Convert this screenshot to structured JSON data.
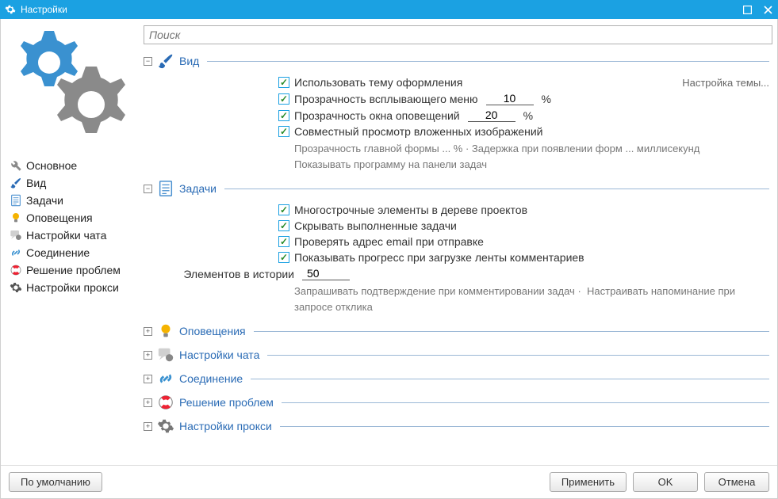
{
  "window": {
    "title": "Настройки"
  },
  "search": {
    "placeholder": "Поиск"
  },
  "sidebar": {
    "items": [
      {
        "label": "Основное"
      },
      {
        "label": "Вид"
      },
      {
        "label": "Задачи"
      },
      {
        "label": "Оповещения"
      },
      {
        "label": "Настройки чата"
      },
      {
        "label": "Соединение"
      },
      {
        "label": "Решение проблем"
      },
      {
        "label": "Настройки прокси"
      }
    ]
  },
  "sections": {
    "view": {
      "title": "Вид",
      "use_theme": "Использовать тему оформления",
      "theme_link": "Настройка темы...",
      "popup_transparency_label": "Прозрачность всплывающего меню",
      "popup_transparency_value": "10",
      "notify_transparency_label": "Прозрачность окна оповещений",
      "notify_transparency_value": "20",
      "percent": "%",
      "shared_view": "Совместный просмотр вложенных изображений",
      "note1_a": "Прозрачность главной формы",
      "note1_b": "... %",
      "note1_c": "·  Задержка при появлении форм",
      "note1_d": "... миллисекунд",
      "note2": "Показывать программу на панели задач"
    },
    "tasks": {
      "title": "Задачи",
      "multiline": "Многострочные элементы в дереве проектов",
      "hide_done": "Скрывать выполненные задачи",
      "check_email": "Проверять адрес email при отправке",
      "show_progress": "Показывать прогресс при загрузке ленты комментариев",
      "history_label": "Элементов в истории",
      "history_value": "50",
      "note_a": "Запрашивать подтверждение при комментировании задач",
      "note_sep": "·",
      "note_b": "Настраивать напоминание при запросе отклика"
    },
    "notifications": {
      "title": "Оповещения"
    },
    "chat": {
      "title": "Настройки чата"
    },
    "connection": {
      "title": "Соединение"
    },
    "troubleshoot": {
      "title": "Решение проблем"
    },
    "proxy": {
      "title": "Настройки прокси"
    }
  },
  "buttons": {
    "defaults": "По умолчанию",
    "apply": "Применить",
    "ok": "OK",
    "cancel": "Отмена"
  }
}
